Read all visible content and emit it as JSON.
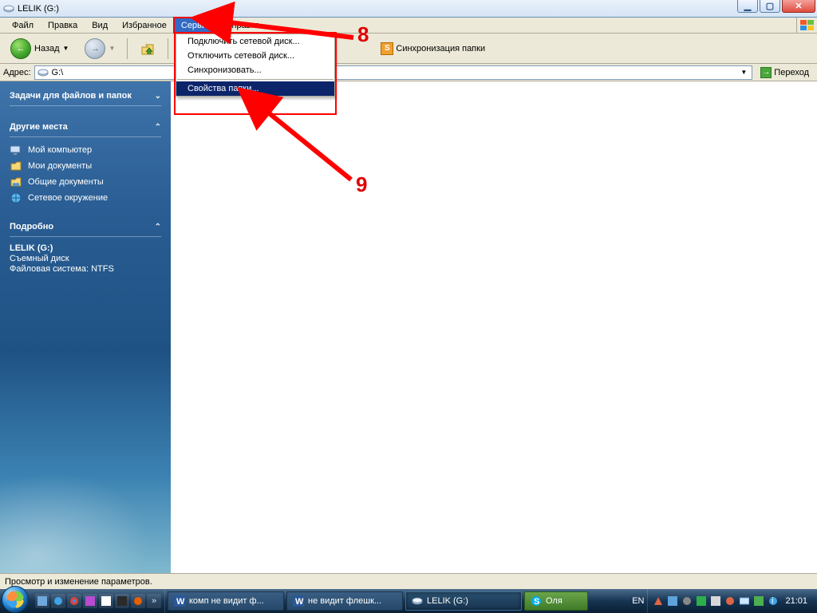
{
  "window": {
    "title": "LELIK (G:)"
  },
  "menu": {
    "items": [
      "Файл",
      "Правка",
      "Вид",
      "Избранное",
      "Сервис",
      "Справка"
    ],
    "active_index": 4
  },
  "dropdown": {
    "items": [
      "Подключить сетевой диск...",
      "Отключить сетевой диск...",
      "Синхронизовать..."
    ],
    "highlighted": "Свойства папки..."
  },
  "toolbar": {
    "back_label": "Назад",
    "sync_label": "Синхронизация папки"
  },
  "address": {
    "label": "Адрес:",
    "value": "G:\\",
    "go_label": "Переход"
  },
  "sidebar": {
    "tasks_head": "Задачи для файлов и папок",
    "places_head": "Другие места",
    "places": [
      {
        "label": "Мой компьютер",
        "icon": "computer"
      },
      {
        "label": "Мои документы",
        "icon": "docs"
      },
      {
        "label": "Общие документы",
        "icon": "shared"
      },
      {
        "label": "Сетевое окружение",
        "icon": "network"
      }
    ],
    "details_head": "Подробно",
    "details_title": "LELIK (G:)",
    "details_type": "Съемный диск",
    "details_fs": "Файловая система: NTFS"
  },
  "statusbar": {
    "text": "Просмотр и изменение параметров."
  },
  "taskbar": {
    "tasks": [
      {
        "label": "комп не видит ф...",
        "icon": "word"
      },
      {
        "label": "не видит флешк...",
        "icon": "word"
      },
      {
        "label": "LELIK (G:)",
        "icon": "drive",
        "active": true
      },
      {
        "label": "Оля",
        "icon": "skype",
        "green": true
      }
    ],
    "lang": "EN",
    "clock": "21:01"
  },
  "annotations": {
    "label8": "8",
    "label9": "9"
  }
}
